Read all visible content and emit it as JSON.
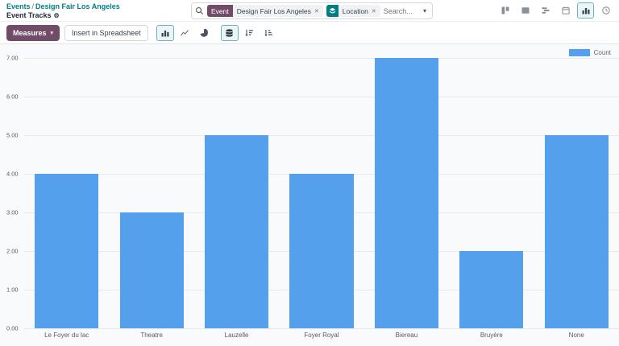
{
  "colors": {
    "teal": "#017e84",
    "maroon": "#714B67",
    "bar_blue": "#54a0ec"
  },
  "icons": {
    "close": "✕",
    "caret_down": "▾",
    "gear": "⚙"
  },
  "breadcrumb": {
    "parent": "Events",
    "separator": "/",
    "current": "Design Fair Los Angeles",
    "subtitle": "Event Tracks"
  },
  "search": {
    "facet_event_label": "Event",
    "facet_event_value": "Design Fair Los Angeles",
    "facet_group_label": "Location",
    "placeholder": "Search..."
  },
  "toolbar": {
    "measures_label": "Measures",
    "insert_spreadsheet_label": "Insert in Spreadsheet"
  },
  "legend": {
    "label": "Count"
  },
  "chart_data": {
    "type": "bar",
    "title": "",
    "xlabel": "",
    "ylabel": "",
    "categories": [
      "Le Foyer du lac",
      "Theatre",
      "Lauzelle",
      "Foyer Royal",
      "Biereau",
      "Bruyère",
      "None"
    ],
    "series": [
      {
        "name": "Count",
        "values": [
          4,
          3,
          5,
          4,
          7,
          2,
          5
        ]
      }
    ],
    "ylim": [
      0,
      7
    ],
    "yticks": [
      "7.00",
      "6.00",
      "5.00",
      "4.00",
      "3.00",
      "2.00",
      "1.00",
      "0.00"
    ],
    "grid": true,
    "legend_position": "top-right",
    "bar_color": "#54a0ec"
  }
}
